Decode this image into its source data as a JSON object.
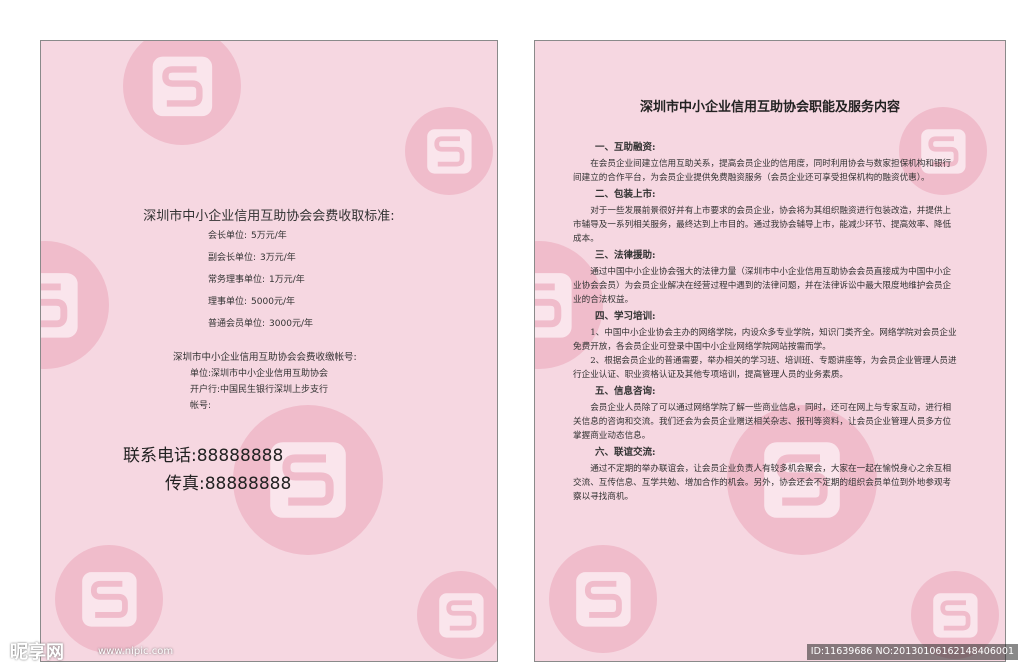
{
  "left": {
    "fee_title": "深圳市中小企业信用互助协会会费收取标准:",
    "fees": [
      {
        "label": "会长单位:",
        "value": "5万元/年"
      },
      {
        "label": "副会长单位:",
        "value": "3万元/年"
      },
      {
        "label": "常务理事单位:",
        "value": "1万元/年"
      },
      {
        "label": "理事单位:",
        "value": "5000元/年"
      },
      {
        "label": "普通会员单位:",
        "value": "3000元/年"
      }
    ],
    "account_title": "深圳市中小企业信用互助协会会费收缴帐号:",
    "account": [
      {
        "label": "单位:",
        "value": "深圳市中小企业信用互助协会"
      },
      {
        "label": "开户行:",
        "value": "中国民生银行深圳上步支行"
      },
      {
        "label": "帐号:",
        "value": ""
      }
    ],
    "phone_label": "联系电话:",
    "phone": "88888888",
    "fax_label": "传真:",
    "fax": "88888888"
  },
  "right": {
    "title": "深圳市中小企业信用互助协会职能及服务内容",
    "sections": [
      {
        "heading": "一、互助融资:",
        "paragraphs": [
          "在会员企业间建立信用互助关系，提高会员企业的信用度，同时利用协会与数家担保机构和银行间建立的合作平台，为会员企业提供免费融资服务（会员企业还可享受担保机构的融资优惠）。"
        ]
      },
      {
        "heading": "二、包装上市:",
        "paragraphs": [
          "对于一些发展前景很好并有上市要求的会员企业，协会将为其组织融资进行包装改造，并提供上市辅导及一系列相关服务，最终达到上市目的。通过我协会辅导上市，能减少环节、提高效率、降低成本。"
        ]
      },
      {
        "heading": "三、法律援助:",
        "paragraphs": [
          "通过中国中小企业协会强大的法律力量（深圳市中小企业信用互助协会会员直接成为中国中小企业协会会员）为会员企业解决在经营过程中遇到的法律问题，并在法律诉讼中最大限度地维护会员企业的合法权益。"
        ]
      },
      {
        "heading": "四、学习培训:",
        "paragraphs": [
          "1、中国中小企业协会主办的网络学院，内设众多专业学院，知识门类齐全。网络学院对会员企业免费开放，各会员企业可登录中国中小企业网络学院网站按需而学。",
          "2、根据会员企业的普通需要，举办相关的学习班、培训班、专题讲座等，为会员企业管理人员进行企业认证、职业资格认证及其他专项培训，提高管理人员的业务素质。"
        ]
      },
      {
        "heading": "五、信息咨询:",
        "paragraphs": [
          "会员企业人员除了可以通过网络学院了解一些商业信息，同时，还可在网上与专家互动，进行相关信息的咨询和交流。我们还会为会员企业赠送相关杂志、报刊等资料，让会员企业管理人员多方位掌握商业动态信息。"
        ]
      },
      {
        "heading": "六、联谊交流:",
        "paragraphs": [
          "通过不定期的举办联谊会，让会员企业负责人有较多机会聚会，大家在一起在愉悦身心之余互相交流、互传信息、互学共勉、增加合作的机会。另外，协会还会不定期的组织会员单位到外地参观考察以寻找商机。"
        ]
      }
    ]
  },
  "watermark": {
    "logo_text": "昵享网",
    "url": "www.nipic.com",
    "id_text": "ID:11639686 NO:20130106162148406001"
  },
  "colors": {
    "page_bg": "#f6d7e1",
    "logo_circle": "#f0bccb",
    "logo_mark": "#fae5ec"
  }
}
